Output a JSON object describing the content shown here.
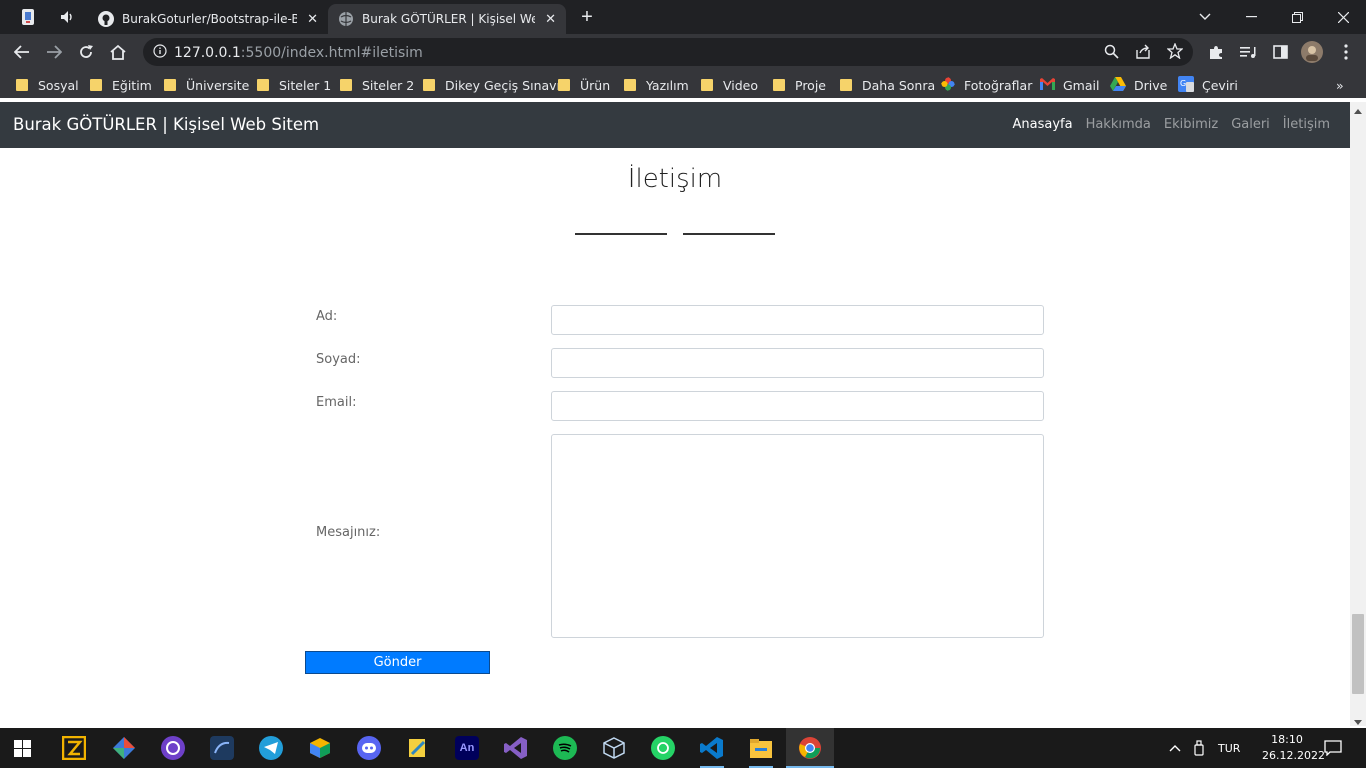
{
  "browser": {
    "tabs": [
      {
        "title": "BurakGoturler/Bootstrap-ile-Basit",
        "active": false
      },
      {
        "title": "Burak GÖTÜRLER | Kişisel Web Site",
        "active": true
      }
    ],
    "url_host": "127.0.0.1",
    "url_path": ":5500/index.html#iletisim",
    "bookmarks": [
      "Sosyal",
      "Eğitim",
      "Üniversite",
      "Siteler 1",
      "Siteler 2",
      "Dikey Geçiş Sınavı",
      "Ürün",
      "Yazılım",
      "Video",
      "Proje",
      "Daha Sonra",
      "Fotoğraflar",
      "Gmail",
      "Drive",
      "Çeviri"
    ]
  },
  "site": {
    "brand": "Burak GÖTÜRLER | Kişisel Web Sitem",
    "nav": [
      "Anasayfa",
      "Hakkımda",
      "Ekibimiz",
      "Galeri",
      "İletişim"
    ],
    "section_title": "İletişim",
    "form": {
      "ad_label": "Ad:",
      "soyad_label": "Soyad:",
      "email_label": "Email:",
      "mesaj_label": "Mesajınız:",
      "submit_label": "Gönder"
    }
  },
  "taskbar": {
    "language": "TUR",
    "time": "18:10",
    "date": "26.12.2022"
  },
  "colors": {
    "accent": "#007bff",
    "navbar": "#343a40",
    "chrome_dark": "#202124",
    "chrome_toolbar": "#35363a"
  }
}
